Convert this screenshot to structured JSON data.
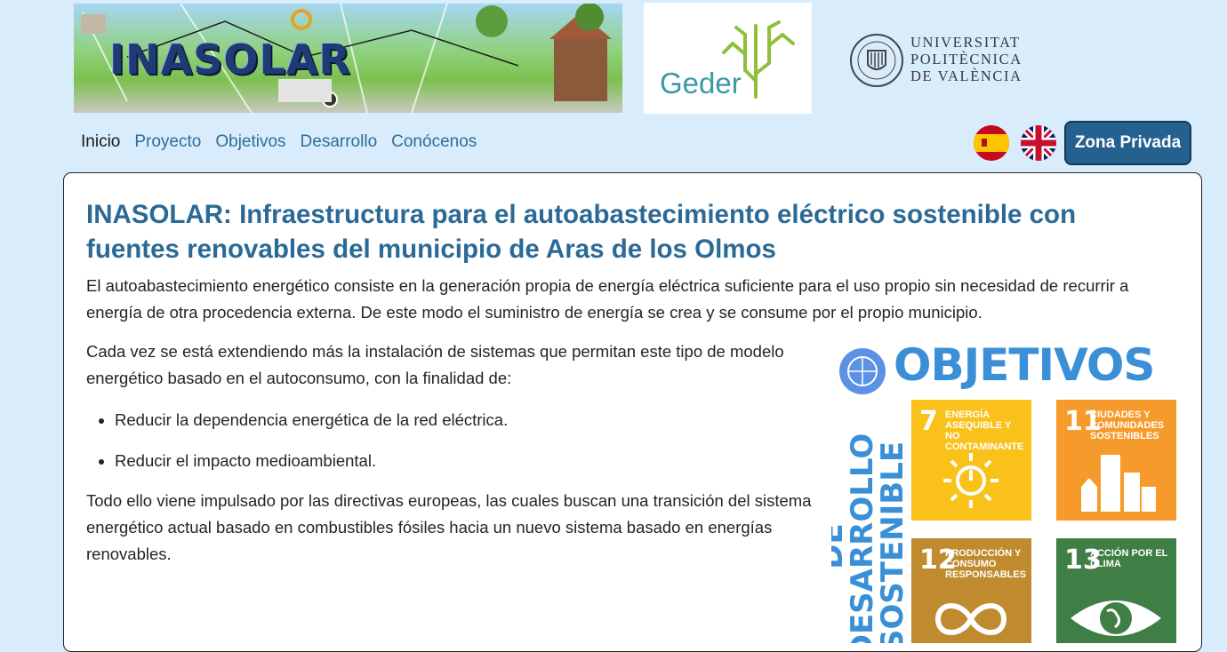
{
  "header": {
    "banner_title": "INASOLAR",
    "partner_logo_text": "Geder",
    "university_lines": [
      "UNIVERSITAT",
      "POLITÈCNICA",
      "DE VALÈNCIA"
    ]
  },
  "nav": {
    "items": [
      {
        "label": "Inicio",
        "active": true
      },
      {
        "label": "Proyecto"
      },
      {
        "label": "Objetivos"
      },
      {
        "label": "Desarrollo"
      },
      {
        "label": "Conócenos"
      }
    ],
    "language_flags": [
      "spain-flag-icon",
      "uk-flag-icon"
    ],
    "private_button": "Zona Privada"
  },
  "main": {
    "title": "INASOLAR: Infraestructura para el autoabastecimiento eléctrico sostenible con fuentes renovables del municipio de Aras de los Olmos",
    "intro": "El autoabastecimiento energético consiste en la generación propia de energía eléctrica suficiente para el uso propio sin necesidad de recurrir a energía de otra procedencia externa. De este modo el suministro de energía se crea y se consume por el propio municipio.",
    "paragraph2": "Cada vez se está extendiendo más la instalación de sistemas que permitan este tipo de modelo energético basado en el autoconsumo, con la finalidad de:",
    "bullets": [
      "Reducir la dependencia energética de la red eléctrica.",
      "Reducir el impacto medioambiental."
    ],
    "paragraph3": "Todo ello viene impulsado por las directivas europeas, las cuales buscan una transición del sistema energético actual basado en combustibles fósiles hacia un nuevo sistema basado en energías renovables."
  },
  "ods_image": {
    "heading": "OBJETIVOS",
    "vertical_text": "DE DESARROLLO SOSTENIBLE",
    "tiles": [
      {
        "number": "7",
        "label": "ENERGÍA ASEQUIBLE Y NO CONTAMINANTE",
        "color": "#f9c11a"
      },
      {
        "number": "11",
        "label": "CIUDADES Y COMUNIDADES SOSTENIBLES",
        "color": "#f69b2b"
      },
      {
        "number": "12",
        "label": "PRODUCCIÓN Y CONSUMO RESPONSABLES",
        "color": "#bf8b2e"
      },
      {
        "number": "13",
        "label": "ACCIÓN POR EL CLIMA",
        "color": "#3f7e44"
      }
    ]
  },
  "colors": {
    "page_background": "#d9ecfb",
    "title": "#2b6a96",
    "nav_link": "#2c6e9b",
    "button": "#24618f"
  }
}
